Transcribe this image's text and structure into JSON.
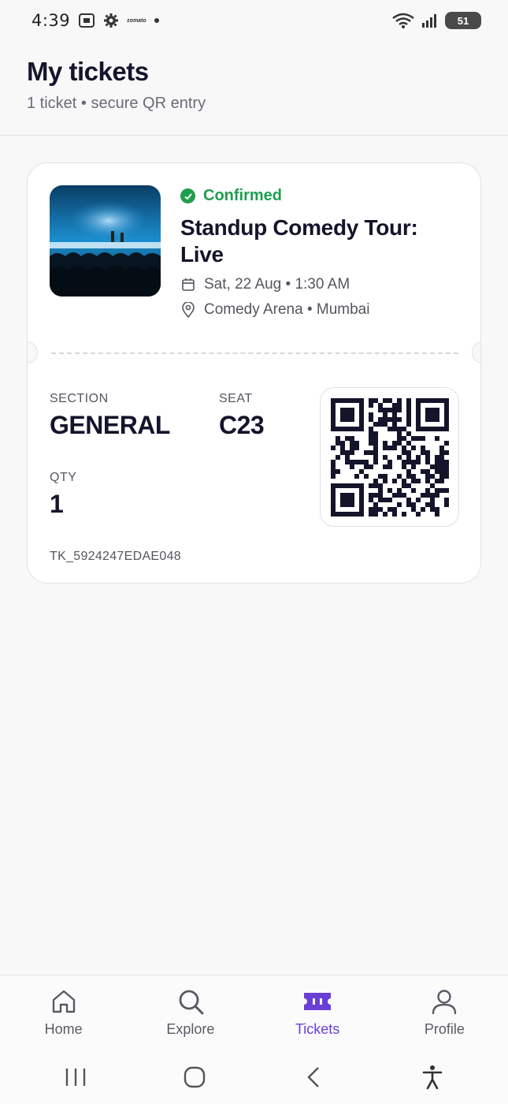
{
  "status_bar": {
    "time": "4:39",
    "tiny_text": "zomato",
    "battery": "51"
  },
  "header": {
    "title": "My tickets",
    "subtitle": "1 ticket • secure QR entry"
  },
  "ticket": {
    "status": "Confirmed",
    "title": "Standup Comedy Tour: Live",
    "date": "Sat, 22 Aug • 1:30 AM",
    "venue": "Comedy Arena • Mumbai",
    "section_label": "SECTION",
    "section_value": "GENERAL",
    "seat_label": "SEAT",
    "seat_value": "C23",
    "qty_label": "QTY",
    "qty_value": "1",
    "ticket_id": "TK_5924247EDAE048"
  },
  "nav": {
    "items": [
      {
        "label": "Home",
        "icon": "home-icon"
      },
      {
        "label": "Explore",
        "icon": "search-icon"
      },
      {
        "label": "Tickets",
        "icon": "ticket-icon"
      },
      {
        "label": "Profile",
        "icon": "profile-icon"
      }
    ],
    "active": "Tickets"
  },
  "colors": {
    "accent": "#6a3fd6",
    "confirmed": "#1e9e4e",
    "text": "#14142b"
  }
}
